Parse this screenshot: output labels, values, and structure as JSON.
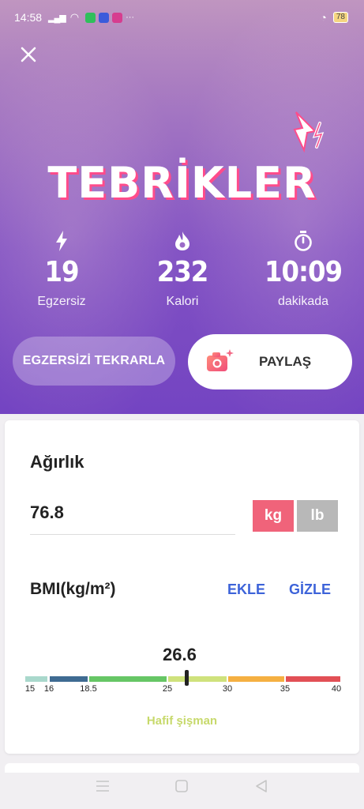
{
  "status_bar": {
    "time": "14:58",
    "battery": "78",
    "more": "···"
  },
  "hero": {
    "title": "TEBRİKLER"
  },
  "stats": [
    {
      "icon": "bolt-icon",
      "value": "19",
      "label": "Egzersiz"
    },
    {
      "icon": "flame-icon",
      "value": "232",
      "label": "Kalori"
    },
    {
      "icon": "stopwatch-icon",
      "value": "10:09",
      "label": "dakikada"
    }
  ],
  "actions": {
    "repeat_label": "EGZERSİZİ TEKRARLA",
    "share_label": "PAYLAŞ"
  },
  "weight": {
    "title": "Ağırlık",
    "value": "76.8",
    "unit_kg": "kg",
    "unit_lb": "lb",
    "selected_unit": "kg"
  },
  "bmi": {
    "title": "BMI(kg/m²)",
    "add_label": "EKLE",
    "hide_label": "GİZLE",
    "value": "26.6",
    "classification": "Hafif şişman",
    "scale_ticks": [
      "15",
      "16",
      "18.5",
      "25",
      "30",
      "35",
      "40"
    ],
    "segments": [
      {
        "from": 15,
        "to": 16,
        "color": "#a9d8cc"
      },
      {
        "from": 16,
        "to": 18.5,
        "color": "#3f6b92"
      },
      {
        "from": 18.5,
        "to": 25,
        "color": "#66c665"
      },
      {
        "from": 25,
        "to": 30,
        "color": "#cfe27c"
      },
      {
        "from": 30,
        "to": 35,
        "color": "#f5b042"
      },
      {
        "from": 35,
        "to": 40,
        "color": "#e24f55"
      }
    ]
  },
  "colors": {
    "accent_pink": "#f0637a",
    "link_blue": "#3d63d9",
    "hero_purple": "#7b4ec6"
  }
}
